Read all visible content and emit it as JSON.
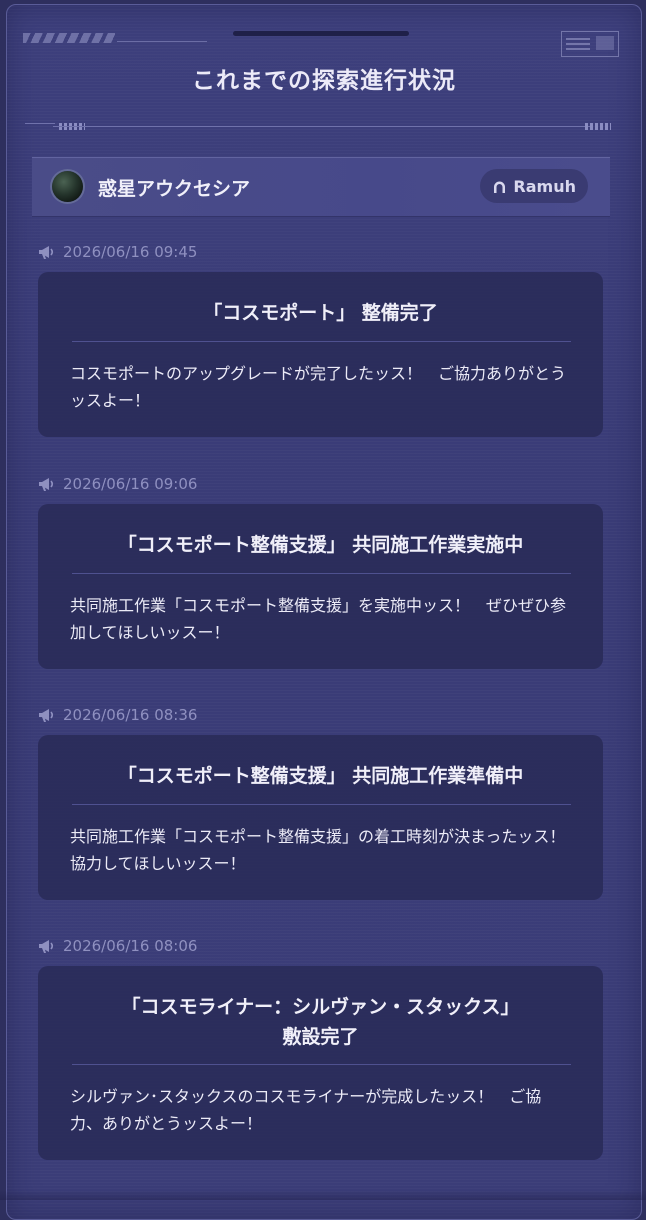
{
  "header": {
    "title": "これまでの探索進行状況"
  },
  "planet": {
    "name": "惑星アウクセシア",
    "world": "Ramuh"
  },
  "entries": [
    {
      "time": "2026/06/16 09:45",
      "title": "「コスモポート」 整備完了",
      "body": "コスモポートのアップグレードが完了したッス！　ご協力ありがとうッスよー！"
    },
    {
      "time": "2026/06/16 09:06",
      "title": "「コスモポート整備支援」 共同施工作業実施中",
      "body": "共同施工作業「コスモポート整備支援」を実施中ッス！　ぜひぜひ参加してほしいッスー！"
    },
    {
      "time": "2026/06/16 08:36",
      "title": "「コスモポート整備支援」 共同施工作業準備中",
      "body": "共同施工作業「コスモポート整備支援」の着工時刻が決まったッス！　協力してほしいッスー！"
    },
    {
      "time": "2026/06/16 08:06",
      "title": "「コスモライナー：シルヴァン・スタックス」",
      "title2": "敷設完了",
      "body": "シルヴァン･スタックスのコスモライナーが完成したッス！　ご協力、ありがとうッスよー！"
    }
  ],
  "colors": {
    "background": "#3b3d78",
    "card": "#282955",
    "accent_text": "#8f90c0"
  },
  "icons": {
    "planet": "planet-icon",
    "world": "world-gate-icon",
    "timestamp": "megaphone-icon"
  }
}
